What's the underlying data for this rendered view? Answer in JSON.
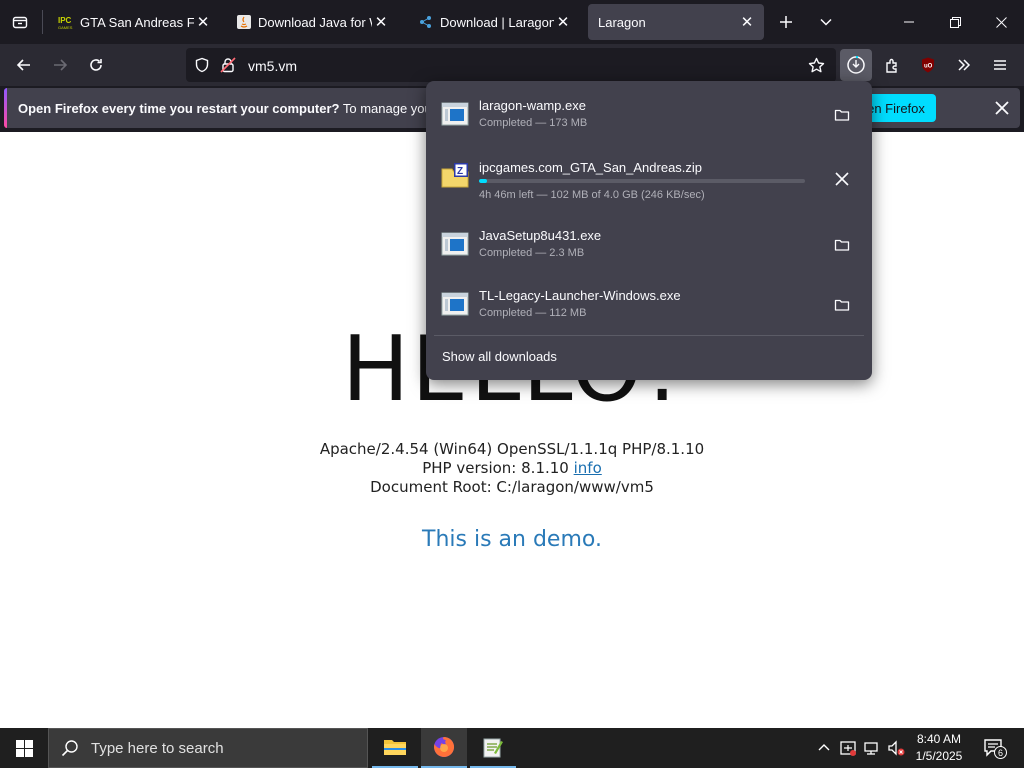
{
  "tabs": [
    {
      "label": "GTA San Andreas Free | ",
      "favicon": "ipc-icon"
    },
    {
      "label": "Download Java for Win",
      "favicon": "java-icon"
    },
    {
      "label": "Download | Laragon - p",
      "favicon": "laragon-icon"
    },
    {
      "label": "Laragon",
      "favicon": "none",
      "active": true
    }
  ],
  "navbar": {
    "url": "vm5.vm"
  },
  "notification": {
    "bold": "Open Firefox every time you restart your computer?",
    "text": " To manage your Start",
    "button": "en Firefox"
  },
  "page": {
    "hello": "HELLO!",
    "server_line": "Apache/2.4.54 (Win64) OpenSSL/1.1.1q PHP/8.1.10",
    "php_prefix": "PHP version: 8.1.10 ",
    "php_link": "info",
    "docroot": "Document Root: C:/laragon/www/vm5",
    "demo": "This is an demo."
  },
  "downloads": {
    "items": [
      {
        "name": "laragon-wamp.exe",
        "status": "Completed — 173 MB",
        "type": "exe"
      },
      {
        "name": "ipcgames.com_GTA_San_Andreas.zip",
        "status": "4h 46m left — 102 MB of 4.0 GB (246 KB/sec)",
        "type": "zip",
        "progress": 0.025
      },
      {
        "name": "JavaSetup8u431.exe",
        "status": "Completed — 2.3 MB",
        "type": "exe"
      },
      {
        "name": "TL-Legacy-Launcher-Windows.exe",
        "status": "Completed — 112 MB",
        "type": "exe"
      }
    ],
    "show_all": "Show all downloads"
  },
  "taskbar": {
    "search_placeholder": "Type here to search",
    "time": "8:40 AM",
    "date": "1/5/2025",
    "notification_count": "6"
  }
}
